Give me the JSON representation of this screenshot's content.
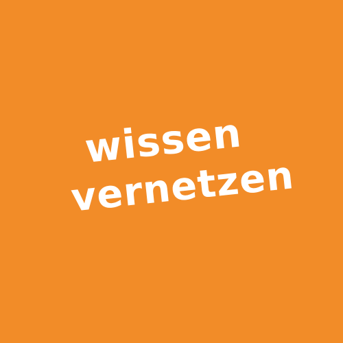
{
  "background_color": "#F28C28",
  "text_color": "#FFFFFF",
  "headline": {
    "line1": "wissen",
    "line2": "vernetzen"
  }
}
